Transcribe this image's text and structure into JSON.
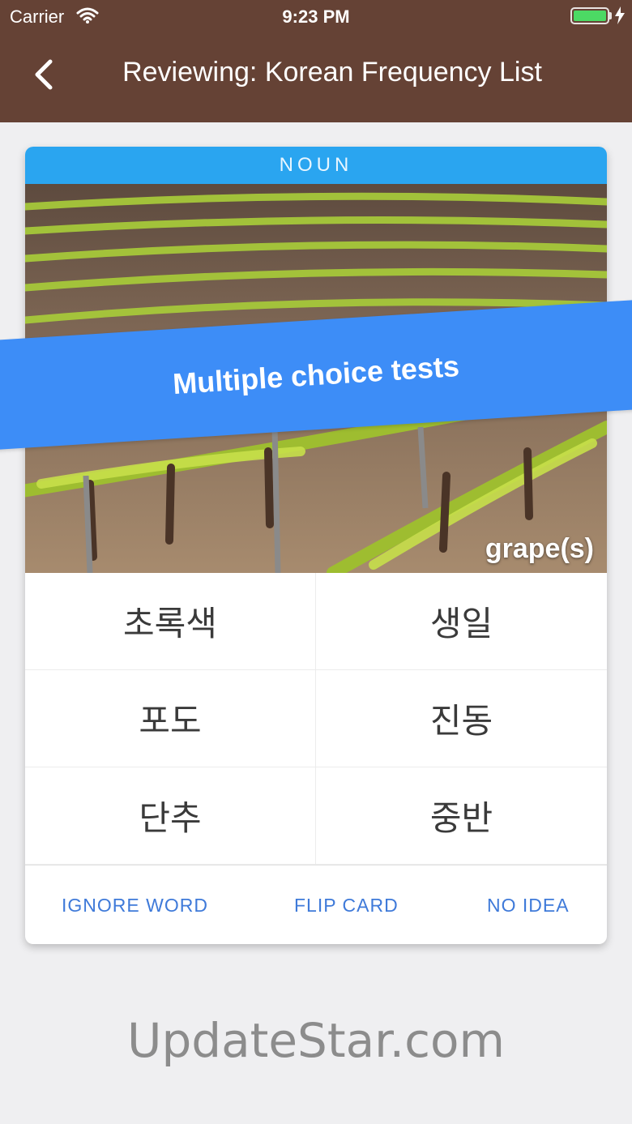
{
  "status_bar": {
    "carrier": "Carrier",
    "time": "9:23 PM"
  },
  "header": {
    "title": "Reviewing: Korean Frequency List",
    "back_icon": "chevron-left-icon"
  },
  "card": {
    "part_of_speech": "NOUN",
    "image_caption": "grape(s)",
    "choices": [
      "초록색",
      "생일",
      "포도",
      "진동",
      "단추",
      "중반"
    ],
    "actions": {
      "ignore": "IGNORE WORD",
      "flip": "FLIP CARD",
      "no_idea": "NO IDEA"
    }
  },
  "ribbon": {
    "text": "Multiple choice tests"
  },
  "watermark": "UpdateStar.com",
  "colors": {
    "header": "#654235",
    "pos_bar": "#2aa5f0",
    "ribbon": "#3d8df7",
    "action_text": "#3f7ad9",
    "battery": "#4cd964"
  }
}
